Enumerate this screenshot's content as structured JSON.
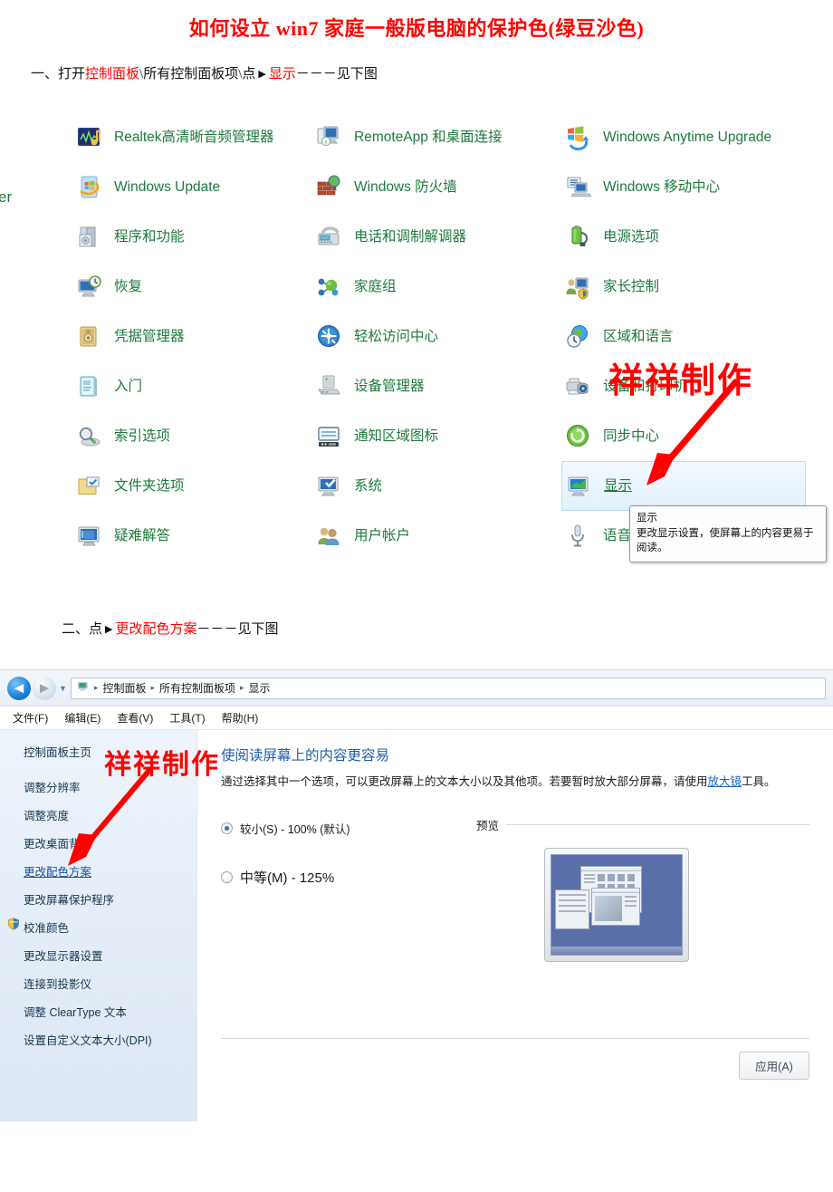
{
  "doc": {
    "title": "如何设立 win7 家庭一般版电脑的保护色(绿豆沙色)",
    "step1_prefix": "一、打开",
    "step1_red1": "控制面板",
    "step1_mid": "\\所有控制面板项\\点",
    "step1_arrow": "▶",
    "step1_red2": "显示",
    "step1_suffix": "－－－见下图",
    "step2_prefix": "二、点",
    "step2_arrow": "▶",
    "step2_red": "更改配色方案",
    "step2_suffix": "－－－见下图"
  },
  "watermark": {
    "top": "祥祥制作",
    "bottom": "祥祥制作"
  },
  "control_panel": {
    "cut_off_left_text": "er",
    "column1": [
      {
        "label": "Realtek高清晰音频管理器",
        "icon": "realtek-audio-icon"
      },
      {
        "label": "Windows Update",
        "icon": "windows-update-icon"
      },
      {
        "label": "程序和功能",
        "icon": "programs-features-icon"
      },
      {
        "label": "恢复",
        "icon": "recovery-icon"
      },
      {
        "label": "凭据管理器",
        "icon": "credential-manager-icon"
      },
      {
        "label": "入门",
        "icon": "getting-started-icon"
      },
      {
        "label": "索引选项",
        "icon": "indexing-options-icon"
      },
      {
        "label": "文件夹选项",
        "icon": "folder-options-icon"
      },
      {
        "label": "疑难解答",
        "icon": "troubleshooting-icon"
      }
    ],
    "column2": [
      {
        "label": "RemoteApp 和桌面连接",
        "icon": "remoteapp-icon"
      },
      {
        "label": "Windows 防火墙",
        "icon": "firewall-icon"
      },
      {
        "label": "电话和调制解调器",
        "icon": "phone-modem-icon"
      },
      {
        "label": "家庭组",
        "icon": "homegroup-icon"
      },
      {
        "label": "轻松访问中心",
        "icon": "ease-of-access-icon"
      },
      {
        "label": "设备管理器",
        "icon": "device-manager-icon"
      },
      {
        "label": "通知区域图标",
        "icon": "notification-area-icon"
      },
      {
        "label": "系统",
        "icon": "system-icon"
      },
      {
        "label": "用户帐户",
        "icon": "user-accounts-icon"
      }
    ],
    "column3": [
      {
        "label": "Windows Anytime Upgrade",
        "icon": "anytime-upgrade-icon"
      },
      {
        "label": "Windows 移动中心",
        "icon": "mobility-center-icon"
      },
      {
        "label": "电源选项",
        "icon": "power-options-icon"
      },
      {
        "label": "家长控制",
        "icon": "parental-controls-icon"
      },
      {
        "label": "区域和语言",
        "icon": "region-language-icon"
      },
      {
        "label": "设备和打印机",
        "icon": "devices-printers-icon"
      },
      {
        "label": "同步中心",
        "icon": "sync-center-icon"
      },
      {
        "label": "显示",
        "icon": "display-icon"
      },
      {
        "label": "语音识别",
        "icon": "speech-recognition-icon"
      }
    ],
    "tooltip": {
      "title": "显示",
      "body": "更改显示设置，使屏幕上的内容更易于阅读。"
    }
  },
  "explorer": {
    "address": {
      "crumbs": [
        "控制面板",
        "所有控制面板项",
        "显示"
      ],
      "separator": "▸"
    },
    "menus": [
      "文件(F)",
      "编辑(E)",
      "查看(V)",
      "工具(T)",
      "帮助(H)"
    ],
    "sidebar": {
      "heading": "控制面板主页",
      "links": [
        {
          "label": "调整分辨率",
          "active": false,
          "shield": false
        },
        {
          "label": "调整亮度",
          "active": false,
          "shield": false
        },
        {
          "label": "更改桌面背景",
          "active": false,
          "shield": false
        },
        {
          "label": "更改配色方案",
          "active": true,
          "shield": false
        },
        {
          "label": "更改屏幕保护程序",
          "active": false,
          "shield": false
        },
        {
          "label": "校准颜色",
          "active": false,
          "shield": true
        },
        {
          "label": "更改显示器设置",
          "active": false,
          "shield": false
        },
        {
          "label": "连接到投影仪",
          "active": false,
          "shield": false
        },
        {
          "label": "调整 ClearType 文本",
          "active": false,
          "shield": false
        },
        {
          "label": "设置自定义文本大小(DPI)",
          "active": false,
          "shield": false
        }
      ]
    },
    "content": {
      "heading": "使阅读屏幕上的内容更容易",
      "desc_part1": "通过选择其中一个选项，可以更改屏幕上的文本大小以及其他项。若要暂时放大部分屏幕，请使用",
      "desc_link": "放大镜",
      "desc_part2": "工具。",
      "options": [
        {
          "label": "较小(S) - 100% (默认)",
          "selected": true
        },
        {
          "label": "中等(M) - 125%",
          "selected": false
        }
      ],
      "preview_label": "预览",
      "apply_button": "应用(A)"
    }
  },
  "colors": {
    "title_red": "#FF0000",
    "item_green": "#1d7a3c",
    "link_blue": "#1b63b5",
    "heading_blue": "#1f5fa9"
  }
}
